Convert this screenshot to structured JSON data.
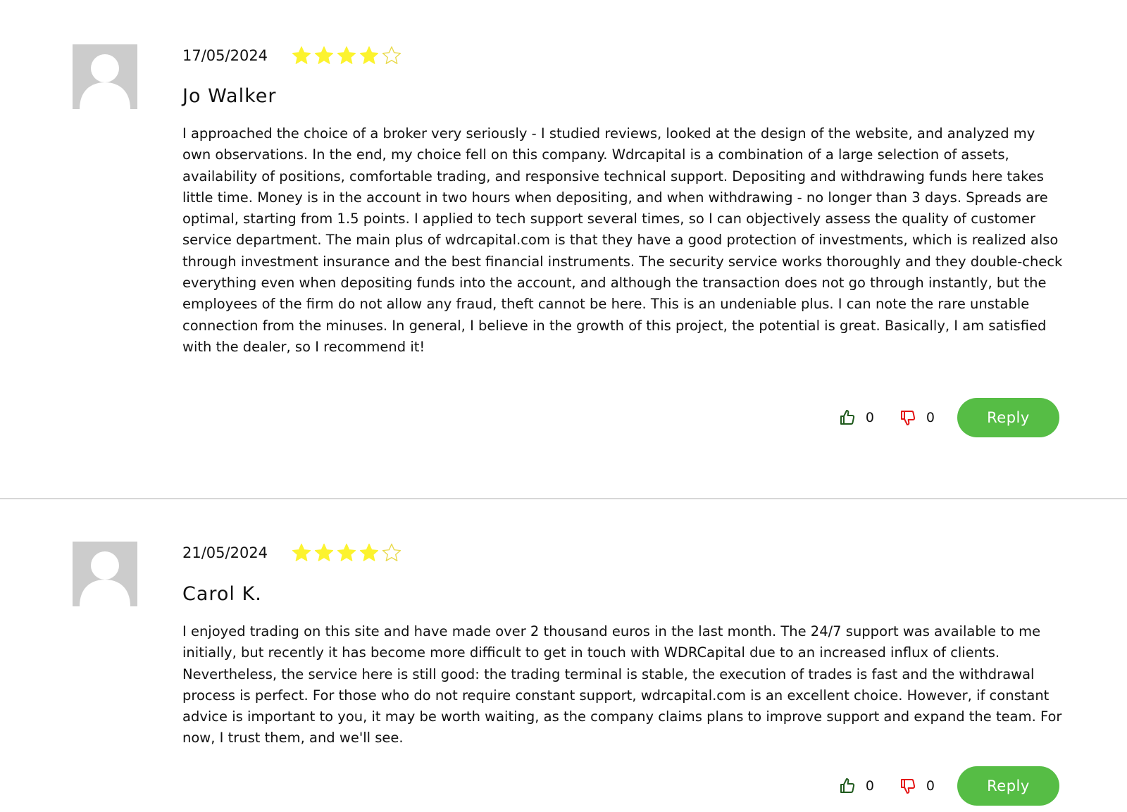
{
  "colors": {
    "star_filled": "#fcf32f",
    "star_empty_stroke": "#e8d94a",
    "like_icon": "#1f5a1c",
    "dislike_icon": "#e41414",
    "reply_button": "#56bd45",
    "avatar_bg": "#cccccc",
    "divider": "#d7d7d7"
  },
  "icons": {
    "avatar": "default-user-silhouette-icon",
    "star": "star-icon",
    "like": "thumbs-up-icon",
    "dislike": "thumbs-down-icon"
  },
  "reviews": [
    {
      "date": "17/05/2024",
      "rating": 4,
      "rating_max": 5,
      "author": "Jo Walker",
      "text": "I approached the choice of a broker very seriously - I studied reviews, looked at the design of the website, and analyzed my own observations. In the end, my choice fell on this company. Wdrcapital is a combination of a large selection of assets, availability of positions, comfortable trading, and responsive technical support. Depositing and withdrawing funds here takes little time. Money is in the account in two hours when depositing, and when withdrawing - no longer than 3 days. Spreads are optimal, starting from 1.5 points. I applied to tech support several times, so I can objectively assess the quality of customer service department. The main plus of wdrcapital.com is that they have a good protection of investments, which is realized also through investment insurance and the best financial instruments. The security service works thoroughly and they double-check everything even when depositing funds into the account, and although the transaction does not go through instantly, but the employees of the firm do not allow any fraud, theft cannot be here. This is an undeniable plus. I can note the rare unstable connection from the minuses. In general, I believe in the growth of this project, the potential is great. Basically, I am satisfied with the dealer, so I recommend it!",
      "likes": "0",
      "dislikes": "0",
      "reply_label": "Reply"
    },
    {
      "date": "21/05/2024",
      "rating": 4,
      "rating_max": 5,
      "author": "Carol K.",
      "text": "I enjoyed trading on this site and have made over 2 thousand euros in the last month. The 24/7 support was available to me initially, but recently it has become more difficult to get in touch with WDRCapital due to an increased influx of clients. Nevertheless, the service here is still good: the trading terminal is stable, the execution of trades is fast and the withdrawal process is perfect. For those who do not require constant support, wdrcapital.com is an excellent choice. However, if constant advice is important to you, it may be worth waiting, as the company claims plans to improve support and expand the team. For now, I trust them, and we'll see.",
      "likes": "0",
      "dislikes": "0",
      "reply_label": "Reply"
    }
  ]
}
